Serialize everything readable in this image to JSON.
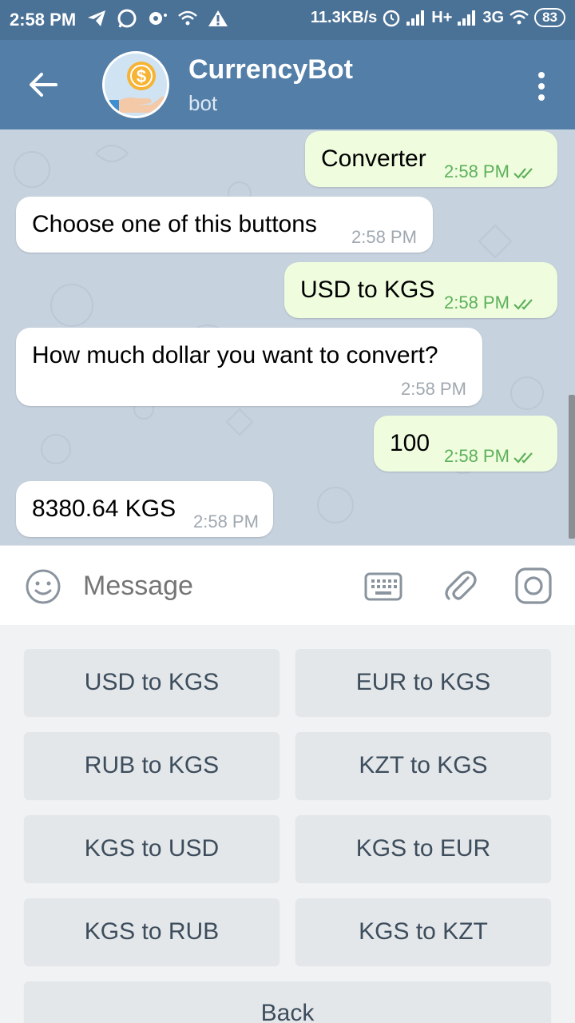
{
  "status_bar": {
    "time": "2:58 PM",
    "speed": "11.3KB/s",
    "network_1": "H+",
    "network_2": "3G",
    "battery": "83"
  },
  "header": {
    "title": "CurrencyBot",
    "subtitle": "bot"
  },
  "messages": [
    {
      "text": "Converter",
      "time": "2:58 PM",
      "direction": "out"
    },
    {
      "text": "Choose one of this buttons",
      "time": "2:58 PM",
      "direction": "in"
    },
    {
      "text": "USD to KGS",
      "time": "2:58 PM",
      "direction": "out"
    },
    {
      "text": "How much dollar you want to convert?",
      "time": "2:58 PM",
      "direction": "in"
    },
    {
      "text": "100",
      "time": "2:58 PM",
      "direction": "out"
    },
    {
      "text": "8380.64 KGS",
      "time": "2:58 PM",
      "direction": "in"
    }
  ],
  "input": {
    "placeholder": "Message"
  },
  "keyboard": {
    "buttons": [
      "USD to KGS",
      "EUR to KGS",
      "RUB to KGS",
      "KZT to KGS",
      "KGS to USD",
      "KGS to EUR",
      "KGS to RUB",
      "KGS to KZT"
    ],
    "back": "Back"
  },
  "colors": {
    "header": "#527ea8",
    "status_bar": "#4a7196",
    "outgoing_bubble": "#effdde",
    "time_out": "#5eb05b"
  }
}
